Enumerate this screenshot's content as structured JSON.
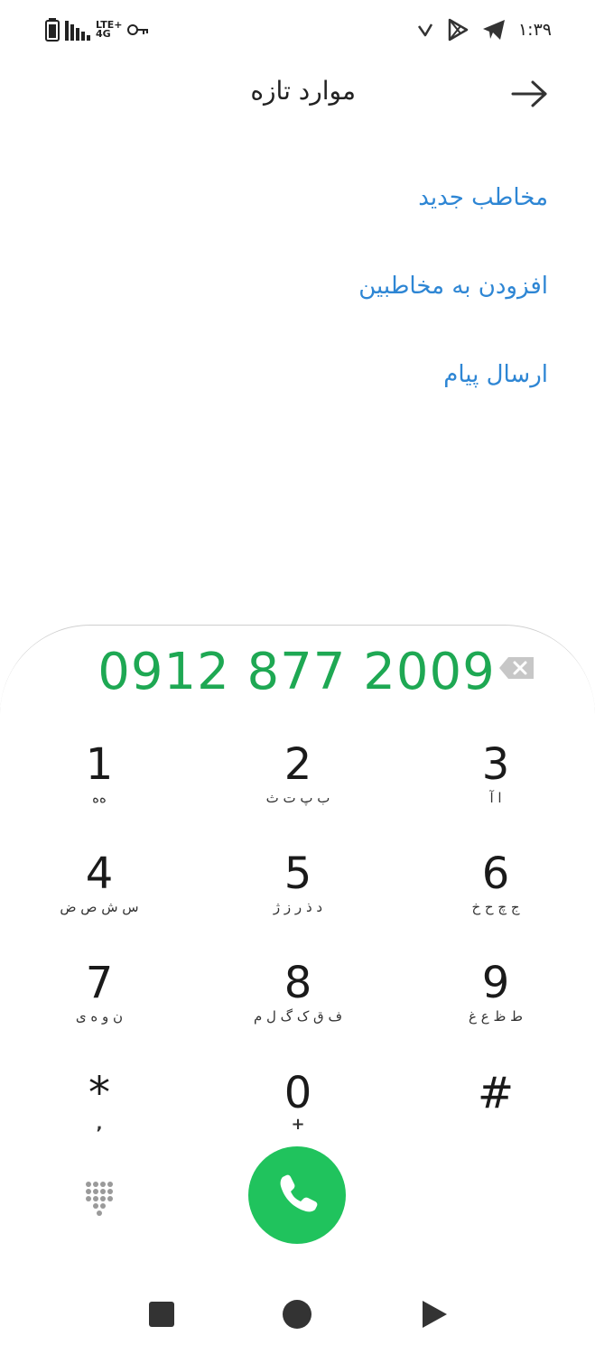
{
  "status_bar": {
    "network": "LTE+",
    "network_sub": "4G",
    "time": "۱:۳۹",
    "icons": [
      "battery-icon",
      "signal-icon",
      "vpn-key-icon",
      "notification-icon",
      "play-store-icon",
      "telegram-icon"
    ]
  },
  "header": {
    "title": "موارد تازه",
    "back_icon": "arrow-right-icon"
  },
  "actions": {
    "new_contact": "مخاطب جدید",
    "add_to_contacts": "افزودن به مخاطبین",
    "send_message": "ارسال پیام"
  },
  "dialer": {
    "number": "0912 877 2009",
    "backspace_icon": "backspace-icon",
    "keys": [
      {
        "digit": "1",
        "letters": "ﻩﻩ"
      },
      {
        "digit": "2",
        "letters": "ب پ ت ث"
      },
      {
        "digit": "3",
        "letters": "ا آ"
      },
      {
        "digit": "4",
        "letters": "س ش ص ض"
      },
      {
        "digit": "5",
        "letters": "د ذ ر ز ژ"
      },
      {
        "digit": "6",
        "letters": "ج چ ح خ"
      },
      {
        "digit": "7",
        "letters": "ن و ه ی"
      },
      {
        "digit": "8",
        "letters": "ف ق ک گ ل م"
      },
      {
        "digit": "9",
        "letters": "ط ظ ع غ"
      },
      {
        "digit": "*",
        "letters": ","
      },
      {
        "digit": "0",
        "letters": "+"
      },
      {
        "digit": "#",
        "letters": ""
      }
    ],
    "colors": {
      "accent": "#1ea853",
      "call": "#20c35d",
      "link": "#2e86d4"
    }
  },
  "nav_bar": {
    "icons": [
      "recents-square-icon",
      "home-circle-icon",
      "back-triangle-icon"
    ]
  }
}
